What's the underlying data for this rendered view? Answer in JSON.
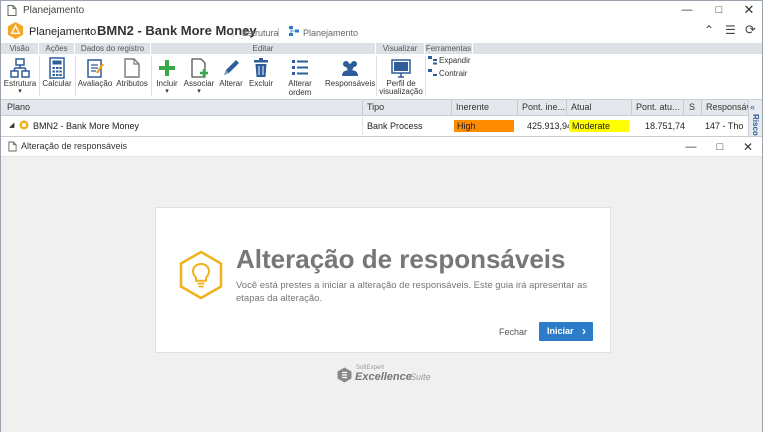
{
  "window": {
    "title": "Planejamento",
    "controls": [
      "minimize-icon",
      "maximize-icon",
      "close-icon"
    ]
  },
  "header": {
    "app_name": "Planejamento",
    "plan_title": "BMN2 - Bank More Money",
    "crumb_structure": "Estrutura",
    "crumb_planning": "Planejamento"
  },
  "ribbon": {
    "groups": {
      "visao": "Visão",
      "acoes": "Ações",
      "dados": "Dados do registro",
      "editar": "Editar",
      "visualizar": "Visualizar",
      "ferramentas": "Ferramentas"
    },
    "buttons": {
      "estrutura": "Estrutura",
      "calcular": "Calcular",
      "avaliacao": "Avaliação",
      "atributos": "Atributos",
      "incluir": "Incluir",
      "associar": "Associar",
      "alterar": "Alterar",
      "excluir": "Excluir",
      "alterar_ordem": "Alterar ordem",
      "responsaveis": "Responsáveis",
      "perfil_1": "Perfil de",
      "perfil_2": "visualização",
      "expandir": "Expandir",
      "contrair": "Contrair"
    }
  },
  "table": {
    "columns": [
      "Plano",
      "Tipo",
      "Inerente",
      "Pont. ine...",
      "Atual",
      "Pont. atu...",
      "S",
      "Responsáv"
    ],
    "row": {
      "plano": "BMN2 - Bank More Money",
      "tipo": "Bank Process",
      "inerente": "High",
      "pont_inerente": "425.913,94",
      "atual": "Moderate",
      "pont_atual": "18.751,74",
      "responsavel": "147 - Tho"
    },
    "side_tab": "Risco",
    "colors": {
      "high": "#ff8c00",
      "moderate": "#ffff00"
    }
  },
  "dialog": {
    "title": "Alteração de responsáveis",
    "heading": "Alteração de responsáveis",
    "description": "Você está prestes a iniciar a alteração de responsáveis. Este guia irá apresentar as etapas da alteração.",
    "close_label": "Fechar",
    "start_label": "Iniciar",
    "brand_top": "SoftExpert",
    "brand_main": "Excellence",
    "brand_suffix": "Suite",
    "accent": "#2d7cc9",
    "icon_color": "#f0b21c"
  }
}
